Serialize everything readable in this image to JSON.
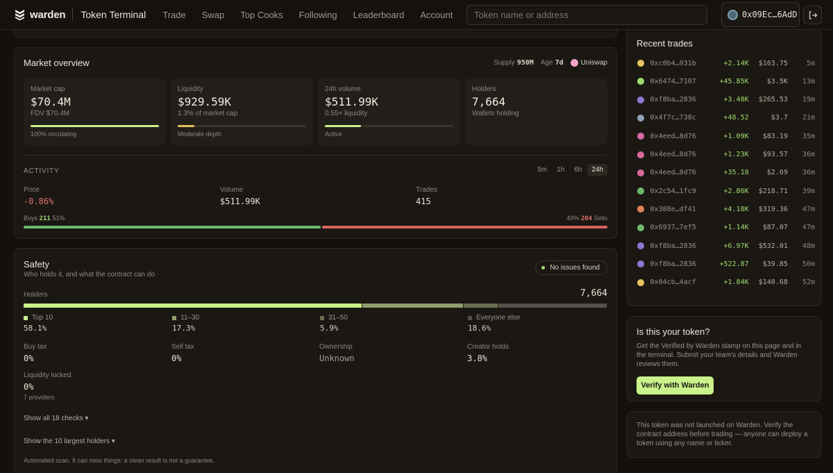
{
  "nav": {
    "brand": "warden",
    "app_title": "Token Terminal",
    "links": [
      "Trade",
      "Swap",
      "Top Cooks",
      "Following",
      "Leaderboard",
      "Account"
    ],
    "search_placeholder": "Token name or address",
    "wallet_address": "0x09Ec…6AdD"
  },
  "market": {
    "title": "Market overview",
    "supply_label": "Supply",
    "supply_value": "950M",
    "age_label": "Age",
    "age_value": "7d",
    "dex": "Uniswap",
    "cards": [
      {
        "label": "Market cap",
        "value": "$70.4M",
        "sub": "FDV $70.4M",
        "foot": "100% circulating",
        "fill": 1.0,
        "color": "#c9f28a"
      },
      {
        "label": "Liquidity",
        "value": "$929.59K",
        "sub": "1.3% of market cap",
        "foot": "Moderate depth",
        "fill": 0.13,
        "color": "#e6c35c"
      },
      {
        "label": "24h volume",
        "value": "$511.99K",
        "sub": "0.55× liquidity",
        "foot": "Active",
        "fill": 0.28,
        "color": "#c9f28a"
      },
      {
        "label": "Holders",
        "value": "7,664",
        "sub": "Wallets holding",
        "foot": "",
        "fill": 0,
        "color": "#c9f28a"
      }
    ],
    "activity": {
      "caption": "ACTIVITY",
      "timeframes": [
        "5m",
        "1h",
        "6h",
        "24h"
      ],
      "active_timeframe": "24h",
      "price_label": "Price",
      "price_value": "-0.86%",
      "volume_label": "Volume",
      "volume_value": "$511.99K",
      "trades_label": "Trades",
      "trades_value": "415",
      "buys_label": "Buys",
      "buys_count": "211",
      "buys_pct": "51%",
      "sells_label": "Sells",
      "sells_count": "204",
      "sells_pct": "49%",
      "buy_share": 0.51,
      "buy_color": "#6fb86a",
      "sell_color": "#d9635f"
    }
  },
  "safety": {
    "title": "Safety",
    "subtitle": "Who holds it, and what the contract can do",
    "badge": "No issues found",
    "holders_label": "Holders",
    "holders_value": "7,664",
    "distribution": [
      {
        "label": "Top 10",
        "value": "58.1%",
        "share": 0.581,
        "color": "#c9f28a"
      },
      {
        "label": "11–30",
        "value": "17.3%",
        "share": 0.173,
        "color": "#8f9e6b"
      },
      {
        "label": "31–50",
        "value": "5.9%",
        "share": 0.059,
        "color": "#6a7050"
      },
      {
        "label": "Everyone else",
        "value": "18.6%",
        "share": 0.186,
        "color": "#55504a"
      }
    ],
    "buy_tax_label": "Buy tax",
    "buy_tax_value": "0%",
    "sell_tax_label": "Sell tax",
    "sell_tax_value": "0%",
    "ownership_label": "Ownership",
    "ownership_value": "Unknown",
    "creator_label": "Creator holds",
    "creator_value": "3.8%",
    "liquidity_label": "Liquidity locked",
    "liquidity_value": "0%",
    "liquidity_sub": "7 providers",
    "show_checks": "Show all 18 checks ▾",
    "show_holders": "Show the 10 largest holders ▾",
    "disclaimer": "Automated scan. It can miss things: a clean result is not a guarantee."
  },
  "trades": {
    "title": "Recent trades",
    "rows": [
      {
        "addr": "0xc0b4…031b",
        "amount": "+2.14K",
        "usd": "$163.75",
        "time": "5m",
        "color": "#e6c35c"
      },
      {
        "addr": "0x6474…7107",
        "amount": "+45.85K",
        "usd": "$3.5K",
        "time": "13m",
        "color": "#9fdc6c"
      },
      {
        "addr": "0xf8ba…2836",
        "amount": "+3.48K",
        "usd": "$265.53",
        "time": "19m",
        "color": "#8b7ad6"
      },
      {
        "addr": "0x4f7c…738c",
        "amount": "+48.52",
        "usd": "$3.7",
        "time": "21m",
        "color": "#8fa0b8"
      },
      {
        "addr": "0x4eed…8d76",
        "amount": "+1.09K",
        "usd": "$83.19",
        "time": "35m",
        "color": "#d96aa0"
      },
      {
        "addr": "0x4eed…8d76",
        "amount": "+1.23K",
        "usd": "$93.57",
        "time": "36m",
        "color": "#d96aa0"
      },
      {
        "addr": "0x4eed…8d76",
        "amount": "+35.18",
        "usd": "$2.69",
        "time": "36m",
        "color": "#d96aa0"
      },
      {
        "addr": "0x2c54…1fc9",
        "amount": "+2.86K",
        "usd": "$218.71",
        "time": "39m",
        "color": "#6fb86a"
      },
      {
        "addr": "0x388e…df41",
        "amount": "+4.18K",
        "usd": "$319.36",
        "time": "47m",
        "color": "#e0815c"
      },
      {
        "addr": "0x6937…7ef5",
        "amount": "+1.14K",
        "usd": "$87.07",
        "time": "47m",
        "color": "#6fb86a"
      },
      {
        "addr": "0xf8ba…2836",
        "amount": "+6.97K",
        "usd": "$532.01",
        "time": "48m",
        "color": "#8b7ad6"
      },
      {
        "addr": "0xf8ba…2836",
        "amount": "+522.87",
        "usd": "$39.85",
        "time": "50m",
        "color": "#8b7ad6"
      },
      {
        "addr": "0x04cb…4acf",
        "amount": "+1.84K",
        "usd": "$140.68",
        "time": "52m",
        "color": "#e6c35c"
      }
    ]
  },
  "claim": {
    "title": "Is this your token?",
    "text": "Get the Verified by Warden stamp on this page and in the terminal. Submit your team's details and Warden reviews them.",
    "button": "Verify with Warden"
  },
  "warning": {
    "text": "This token was not launched on Warden. Verify the contract address before trading — anyone can deploy a token using any name or ticker."
  }
}
